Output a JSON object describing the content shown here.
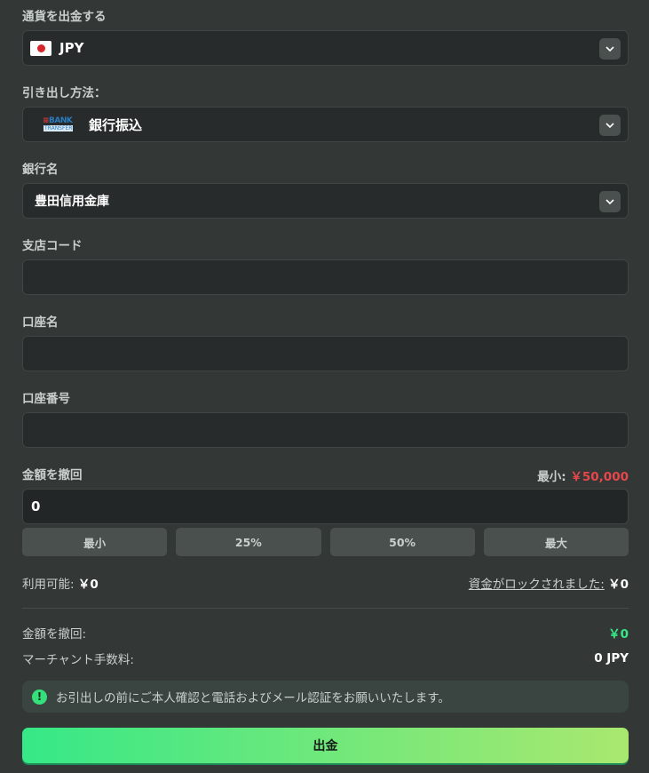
{
  "currency": {
    "label": "通貨を出金する",
    "value": "JPY"
  },
  "method": {
    "label": "引き出し方法：",
    "value": "銀行振込",
    "logo_top": "BANK",
    "logo_bottom": "TRANSFER"
  },
  "bank": {
    "label": "銀行名",
    "value": "豊田信用金庫"
  },
  "branch": {
    "label": "支店コード",
    "value": ""
  },
  "account_name": {
    "label": "口座名",
    "value": ""
  },
  "account_number": {
    "label": "口座番号",
    "value": ""
  },
  "amount": {
    "label": "金額を撤回",
    "min_label": "最小:",
    "min_value": "￥50,000",
    "value": "0",
    "quick": [
      "最小",
      "25%",
      "50%",
      "最大"
    ]
  },
  "balance": {
    "available_label": "利用可能:",
    "available_value": "￥0",
    "locked_label": "資金がロックされました:",
    "locked_value": "￥0"
  },
  "summary": {
    "withdraw_label": "金額を撤回:",
    "withdraw_value": "￥0",
    "fee_label": "マーチャント手数料:",
    "fee_value": "0 JPY"
  },
  "notice": {
    "icon": "!",
    "text": "お引出しの前にご本人確認と電話およびメール認証をお願いいたします。"
  },
  "submit_label": "出金",
  "colors": {
    "accent_green": "#36e887",
    "accent_lime": "#a9e86f",
    "min_red": "#e7474a",
    "background": "#333837"
  }
}
